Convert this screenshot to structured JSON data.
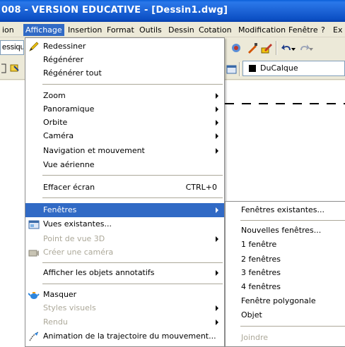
{
  "window": {
    "title": "008 - VERSION EDUCATIVE - [Dessin1.dwg]"
  },
  "menubar": {
    "items": [
      "ion",
      "Affichage",
      "Insertion",
      "Format",
      "Outils",
      "Dessin",
      "Cotation",
      "Modification",
      "Fenêtre",
      "?",
      "Ex"
    ],
    "active": "Affichage"
  },
  "toolbar": {
    "style_combo": "essiqu",
    "layer_value": "DuCalque",
    "layer_swatch_color": "#000000"
  },
  "menu": {
    "items": [
      {
        "label": "Redessiner",
        "icon": "pencil-icon"
      },
      {
        "label": "Régénérer"
      },
      {
        "label": "Régénérer tout"
      },
      {
        "label": "Zoom"
      },
      {
        "label": "Panoramique"
      },
      {
        "label": "Orbite"
      },
      {
        "label": "Caméra"
      },
      {
        "label": "Navigation et mouvement"
      },
      {
        "label": "Vue aérienne"
      },
      {
        "label": "Effacer écran",
        "shortcut": "CTRL+0"
      },
      {
        "label": "Fenêtres"
      },
      {
        "label": "Vues existantes...",
        "icon": "views-icon"
      },
      {
        "label": "Point de vue 3D"
      },
      {
        "label": "Créer une caméra",
        "icon": "camera-icon"
      },
      {
        "label": "Afficher les objets annotatifs"
      },
      {
        "label": "Masquer",
        "icon": "teapot-icon"
      },
      {
        "label": "Styles visuels"
      },
      {
        "label": "Rendu"
      },
      {
        "label": "Animation de la trajectoire du mouvement...",
        "icon": "motion-path-icon"
      }
    ]
  },
  "submenu": {
    "items": [
      {
        "label": "Fenêtres existantes..."
      },
      {
        "label": "Nouvelles fenêtres..."
      },
      {
        "label": "1 fenêtre"
      },
      {
        "label": "2 fenêtres"
      },
      {
        "label": "3 fenêtres"
      },
      {
        "label": "4 fenêtres"
      },
      {
        "label": "Fenêtre polygonale"
      },
      {
        "label": "Objet"
      },
      {
        "label": "Joindre"
      }
    ]
  },
  "colors": {
    "highlight": "#316ac5",
    "titlebar": "#0a5fd8",
    "disabled": "#aca899"
  }
}
